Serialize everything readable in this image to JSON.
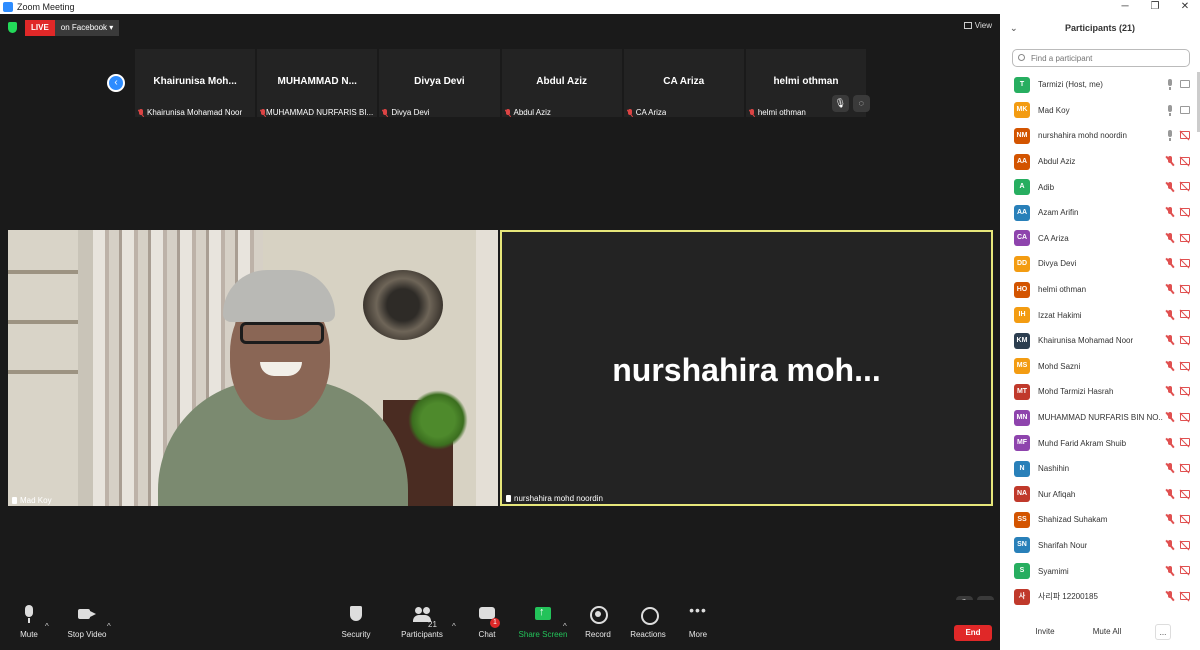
{
  "window": {
    "title": "Zoom Meeting"
  },
  "header": {
    "live": "LIVE",
    "live_target": "on Facebook ▾",
    "view_label": "View"
  },
  "strip": {
    "tiles": [
      {
        "name": "Khairunisa  Moh...",
        "label": "Khairunisa Mohamad Noor"
      },
      {
        "name": "MUHAMMAD  N...",
        "label": "MUHAMMAD NURFARIS BI..."
      },
      {
        "name": "Divya Devi",
        "label": "Divya Devi"
      },
      {
        "name": "Abdul Aziz",
        "label": "Abdul Aziz"
      },
      {
        "name": "CA Ariza",
        "label": "CA Ariza"
      },
      {
        "name": "helmi othman",
        "label": "helmi othman"
      }
    ]
  },
  "main": {
    "left_label": "Mad Koy",
    "right_name": "nurshahira  moh...",
    "right_label": "nurshahira mohd noordin"
  },
  "toolbar": {
    "mute": "Mute",
    "stop_video": "Stop Video",
    "security": "Security",
    "participants": "Participants",
    "participants_count": "21",
    "chat": "Chat",
    "chat_badge": "1",
    "share": "Share Screen",
    "record": "Record",
    "reactions": "Reactions",
    "more": "More",
    "end": "End"
  },
  "panel": {
    "title": "Participants (21)",
    "search_placeholder": "Find a participant",
    "invite": "Invite",
    "mute_all": "Mute All",
    "more": "...",
    "participants": [
      {
        "initials": "T",
        "name": "Tarmizi (Host, me)",
        "color": "#27ae60"
      },
      {
        "initials": "MK",
        "name": "Mad Koy",
        "color": "#f39c12"
      },
      {
        "initials": "NM",
        "name": "nurshahira mohd noordin",
        "color": "#d35400"
      },
      {
        "initials": "AA",
        "name": "Abdul Aziz",
        "color": "#d35400"
      },
      {
        "initials": "A",
        "name": "Adib",
        "color": "#27ae60"
      },
      {
        "initials": "AA",
        "name": "Azam Arifin",
        "color": "#2980b9"
      },
      {
        "initials": "CA",
        "name": "CA Ariza",
        "color": "#8e44ad"
      },
      {
        "initials": "DD",
        "name": "Divya Devi",
        "color": "#f39c12"
      },
      {
        "initials": "HO",
        "name": "helmi othman",
        "color": "#d35400"
      },
      {
        "initials": "IH",
        "name": "Izzat Hakimi",
        "color": "#f39c12"
      },
      {
        "initials": "KM",
        "name": "Khairunisa Mohamad Noor",
        "color": "#2c3e50"
      },
      {
        "initials": "MS",
        "name": "Mohd Sazni",
        "color": "#f39c12"
      },
      {
        "initials": "MT",
        "name": "Mohd Tarmizi Hasrah",
        "color": "#c0392b"
      },
      {
        "initials": "MN",
        "name": "MUHAMMAD NURFARIS BIN NO...",
        "color": "#8e44ad"
      },
      {
        "initials": "MF",
        "name": "Muhd Farid Akram Shuib",
        "color": "#8e44ad"
      },
      {
        "initials": "N",
        "name": "Nashihin",
        "color": "#2980b9"
      },
      {
        "initials": "NA",
        "name": "Nur Afiqah",
        "color": "#c0392b"
      },
      {
        "initials": "SS",
        "name": "Shahizad Suhakam",
        "color": "#d35400"
      },
      {
        "initials": "SN",
        "name": "Sharifah Nour",
        "color": "#2980b9"
      },
      {
        "initials": "S",
        "name": "Syamimi",
        "color": "#27ae60"
      },
      {
        "initials": "사",
        "name": "사리파 12200185",
        "color": "#c0392b"
      }
    ]
  }
}
